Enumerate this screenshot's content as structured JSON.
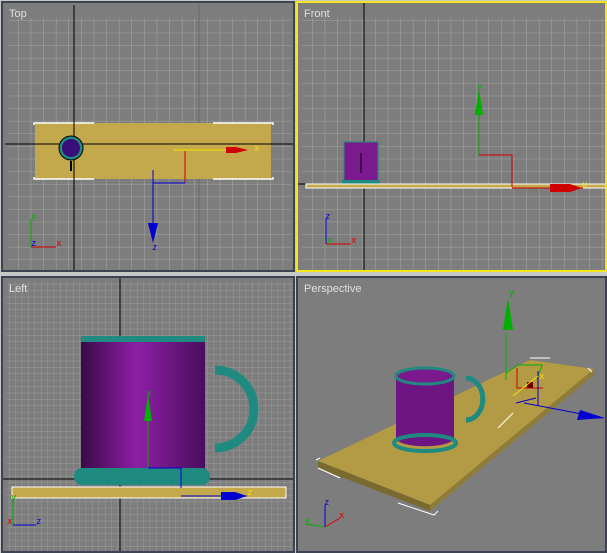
{
  "viewports": {
    "top": {
      "label": "Top"
    },
    "front": {
      "label": "Front",
      "active": true
    },
    "left": {
      "label": "Left"
    },
    "perspective": {
      "label": "Perspective"
    }
  },
  "axes": {
    "x": "x",
    "y": "y",
    "z": "z"
  },
  "colors": {
    "grid_bg": "#7d7d7d",
    "active_border": "#f5e51c",
    "border": "#3d4350",
    "plane": "#c4a94c",
    "mug": "#7a1a8e",
    "mug_trim": "#1e8a80",
    "x_axis": "#e00000",
    "y_axis": "#00b000",
    "z_axis": "#0000e0"
  }
}
